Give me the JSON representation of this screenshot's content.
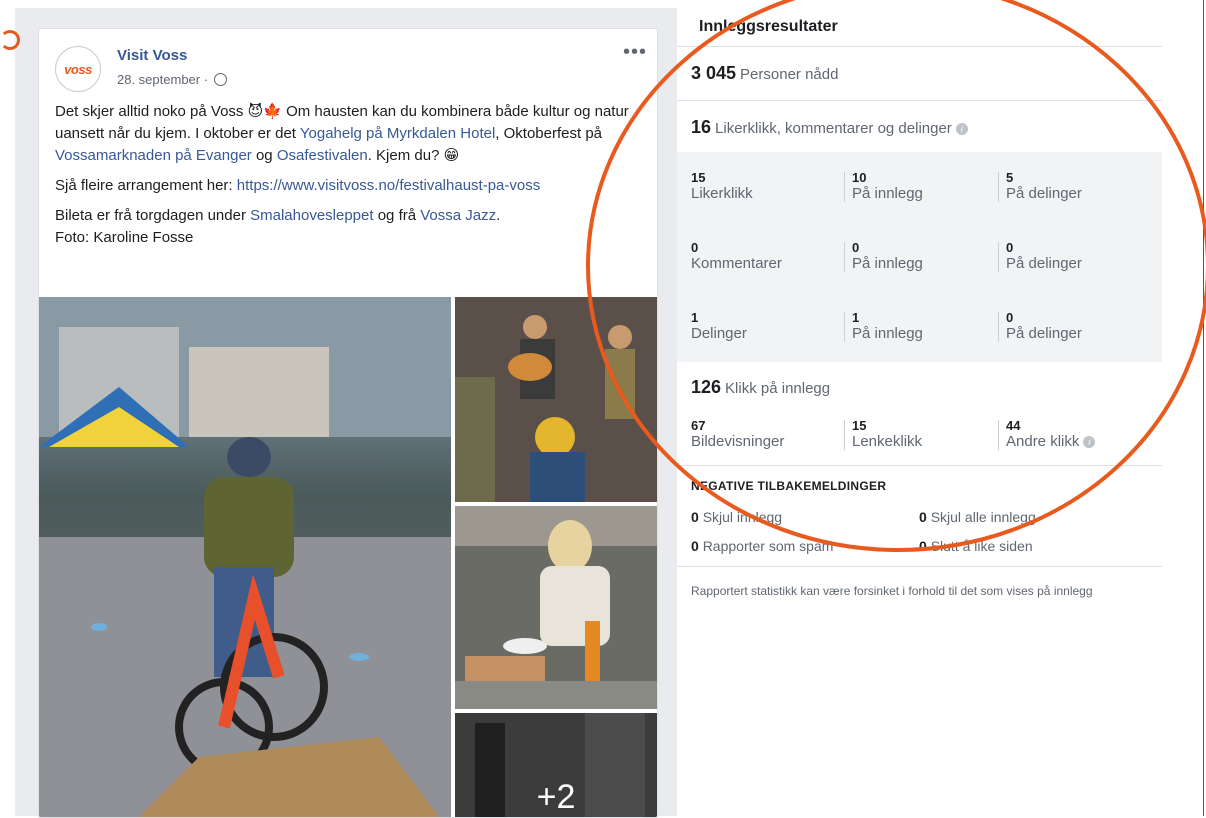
{
  "post": {
    "avatar_text": "voss",
    "page_name": "Visit Voss",
    "date": "28. september",
    "more": "•••",
    "text_1_a": "Det skjer alltid noko på Voss 😈🍁 Om hausten kan du kombinera både kultur og natur uansett når du kjem. I oktober er det ",
    "text_1_link1": "Yogahelg på Myrkdalen Hotel",
    "text_1_b": ", Oktoberfest på ",
    "text_1_link2": "Vossamarknaden på Evanger",
    "text_1_c": " og ",
    "text_1_link3": "Osafestivalen",
    "text_1_d": ". Kjem du? 😁",
    "text_2_a": "Sjå fleire arrangement her: ",
    "text_2_link": "https://www.visitvoss.no/festivalhaust-pa-voss",
    "text_3_a": "Bileta er frå torgdagen under ",
    "text_3_link1": "Smalahovesleppet",
    "text_3_b": " og frå ",
    "text_3_link2": "Vossa Jazz",
    "text_3_c": ".",
    "text_3_d": "Foto: Karoline Fosse",
    "more_photos": "+2"
  },
  "insights": {
    "title": "Innleggsresultater",
    "reach_num": "3 045",
    "reach_label": "Personer nådd",
    "engage_num": "16",
    "engage_label": "Likerklikk, kommentarer og delinger",
    "rows": [
      [
        {
          "v": "15",
          "l": "Likerklikk"
        },
        {
          "v": "10",
          "l": "På innlegg"
        },
        {
          "v": "5",
          "l": "På delinger"
        }
      ],
      [
        {
          "v": "0",
          "l": "Kommentarer"
        },
        {
          "v": "0",
          "l": "På innlegg"
        },
        {
          "v": "0",
          "l": "På delinger"
        }
      ],
      [
        {
          "v": "1",
          "l": "Delinger"
        },
        {
          "v": "1",
          "l": "På innlegg"
        },
        {
          "v": "0",
          "l": "På delinger"
        }
      ]
    ],
    "clicks_num": "126",
    "clicks_label": "Klikk på innlegg",
    "clicks": [
      {
        "v": "67",
        "l": "Bildevisninger"
      },
      {
        "v": "15",
        "l": "Lenkeklikk"
      },
      {
        "v": "44",
        "l": "Andre klikk"
      }
    ],
    "neg_title": "NEGATIVE TILBAKEMELDINGER",
    "neg": [
      {
        "n": "0",
        "l": "Skjul innlegg"
      },
      {
        "n": "0",
        "l": "Skjul alle innlegg"
      },
      {
        "n": "0",
        "l": "Rapporter som spam"
      },
      {
        "n": "0",
        "l": "Slutt å like siden"
      }
    ],
    "footnote": "Rapportert statistikk kan være forsinket i forhold til det som vises på innlegg"
  },
  "colors": {
    "annotation": "#e85a1e",
    "link": "#385898"
  }
}
